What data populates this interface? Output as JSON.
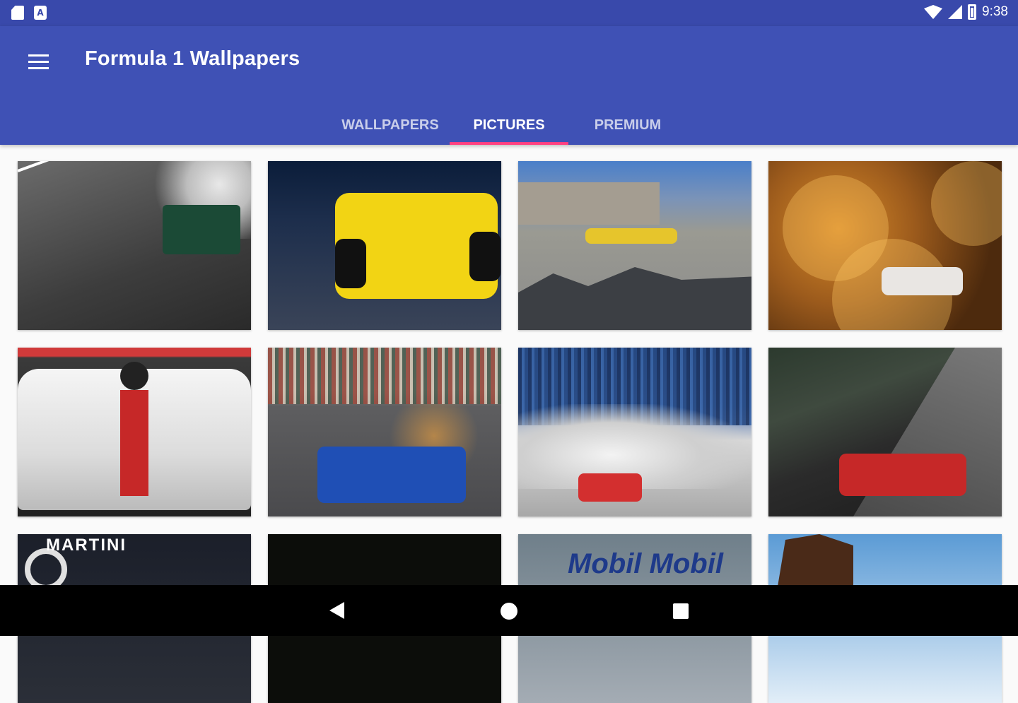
{
  "status_bar": {
    "time": "9:38",
    "icons": [
      "sd-card-icon",
      "app-a-icon",
      "wifi-icon",
      "signal-icon",
      "battery-icon"
    ]
  },
  "app_bar": {
    "title": "Formula 1 Wallpapers",
    "menu_icon": "hamburger-menu-icon",
    "background_color": "#3f51b5",
    "status_bar_color": "#3949ab"
  },
  "tabs": [
    {
      "label": "WALLPAPERS",
      "active": false
    },
    {
      "label": "PICTURES",
      "active": true
    },
    {
      "label": "PREMIUM",
      "active": false
    }
  ],
  "tab_indicator_color": "#ff4081",
  "gallery": {
    "tiles": [
      {
        "overlay_text": ""
      },
      {
        "overlay_text": ""
      },
      {
        "overlay_text": ""
      },
      {
        "overlay_text": ""
      },
      {
        "overlay_text": ""
      },
      {
        "overlay_text": ""
      },
      {
        "overlay_text": ""
      },
      {
        "overlay_text": ""
      },
      {
        "overlay_text": "MARTINI"
      },
      {
        "overlay_text": ""
      },
      {
        "overlay_text": "Mobil Mobil"
      },
      {
        "overlay_text": ""
      }
    ]
  },
  "nav_bar": {
    "icons": [
      "back-icon",
      "home-icon",
      "recents-icon"
    ]
  }
}
